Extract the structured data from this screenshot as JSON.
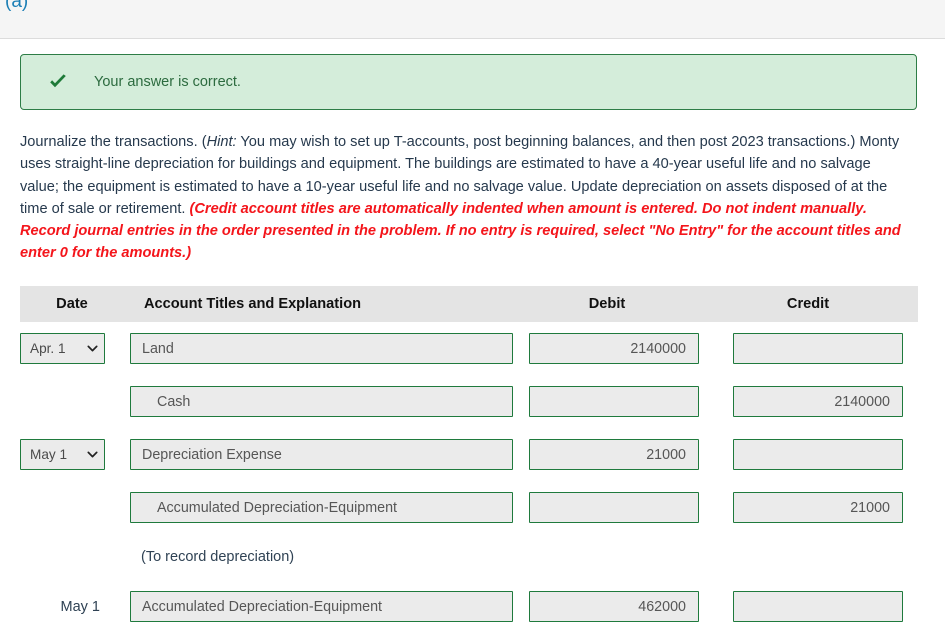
{
  "part_label": "(a)",
  "alert": {
    "icon": "check-icon",
    "message": "Your answer is correct."
  },
  "instructions": {
    "line_1": "Journalize the transactions. (",
    "hint_label": "Hint:",
    "line_2": " You may wish to set up T-accounts, post beginning balances, and then post 2023 transactions.) Monty uses straight-line depreciation for buildings and equipment. The buildings are estimated to have a 40-year useful life and no salvage value; the equipment is estimated to have a 10-year useful life and no salvage value. Update depreciation on assets disposed of at the time of sale or retirement. ",
    "red_note": "(Credit account titles are automatically indented when amount is entered. Do not indent manually. Record journal entries in the order presented in the problem. If no entry is required, select \"No Entry\" for the account titles and enter 0 for the amounts.)"
  },
  "table": {
    "headers": {
      "date": "Date",
      "account": "Account Titles and Explanation",
      "debit": "Debit",
      "credit": "Credit"
    },
    "rows": [
      {
        "kind": "entry",
        "date_type": "select",
        "date": "Apr. 1",
        "account": "Land",
        "indent": false,
        "debit": "2140000",
        "credit": ""
      },
      {
        "kind": "entry",
        "date_type": "none",
        "date": "",
        "account": "Cash",
        "indent": true,
        "debit": "",
        "credit": "2140000"
      },
      {
        "kind": "entry",
        "date_type": "select",
        "date": "May 1",
        "account": "Depreciation Expense",
        "indent": false,
        "debit": "21000",
        "credit": ""
      },
      {
        "kind": "entry",
        "date_type": "none",
        "date": "",
        "account": "Accumulated Depreciation-Equipment",
        "indent": true,
        "debit": "",
        "credit": "21000"
      },
      {
        "kind": "memo",
        "text": "(To record depreciation)"
      },
      {
        "kind": "entry",
        "date_type": "text",
        "date": "May 1",
        "account": "Accumulated Depreciation-Equipment",
        "indent": false,
        "debit": "462000",
        "credit": ""
      }
    ]
  },
  "colors": {
    "accent_blue": "#1b7eb5",
    "success_bg": "#d4edda",
    "success_border": "#2d7d46",
    "success_text": "#2c6b3f",
    "input_border": "#1f7a3d",
    "input_bg": "#ebebeb",
    "header_bg": "#e4e4e4",
    "warning_red": "#f4151b"
  }
}
